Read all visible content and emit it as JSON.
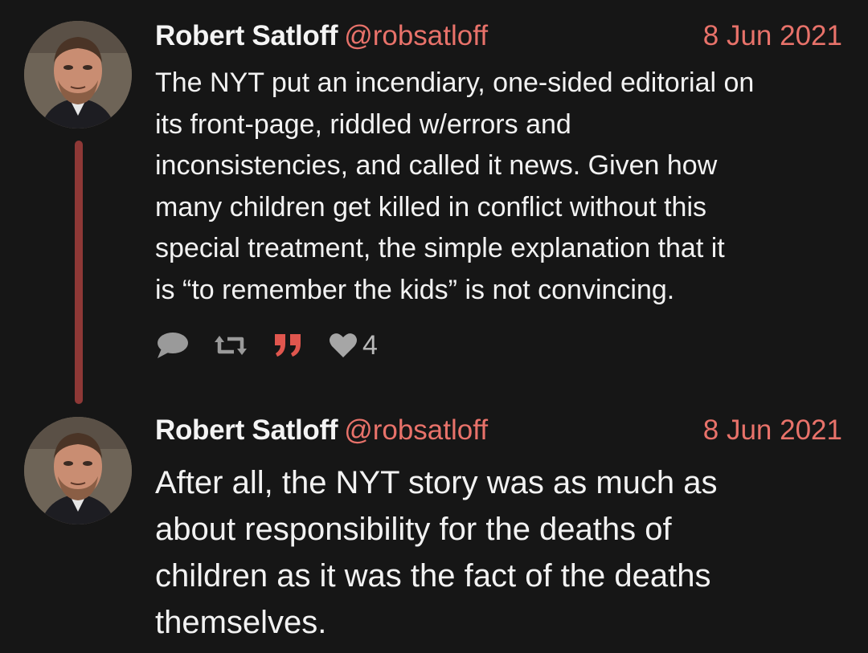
{
  "tweets": [
    {
      "author_name": "Robert Satloff",
      "handle": "@robsatloff",
      "date": "8 Jun 2021",
      "text": "The NYT put an incendiary, one-sided editorial on\nits front-page, riddled w/errors and\ninconsistencies, and called it news. Given how\nmany children get killed in conflict without this\nspecial treatment, the simple explanation that it\nis “to remember the kids” is not convincing.",
      "actions": {
        "reply_icon": "speech-bubble-icon",
        "retweet_icon": "retweet-icon",
        "quote_icon": "quote-icon",
        "like_icon": "heart-icon",
        "like_count": "4"
      }
    },
    {
      "author_name": "Robert Satloff",
      "handle": "@robsatloff",
      "date": "8 Jun 2021",
      "text": "After all, the NYT story was as much as\nabout responsibility for the deaths of\nchildren as it was the fact of the deaths\nthemselves."
    }
  ],
  "colors": {
    "background": "#161616",
    "text": "#f2f2f2",
    "accent": "#e8726a",
    "thread_line": "#8e3836",
    "icon_gray": "#9a9a9a",
    "quote_icon": "#e0564e"
  }
}
